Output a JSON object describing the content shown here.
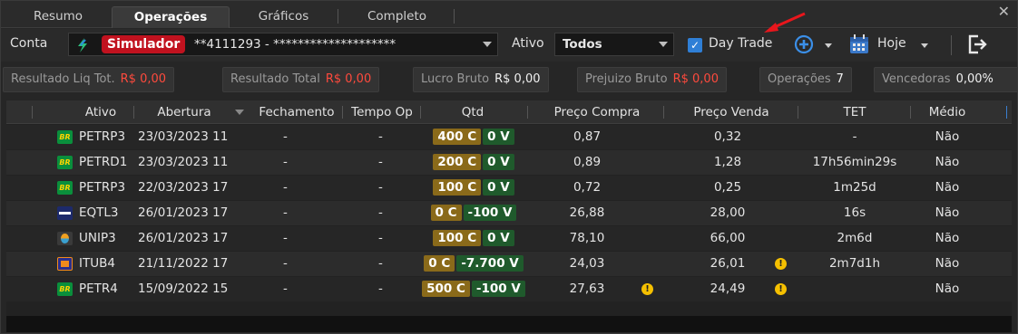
{
  "tabs": [
    {
      "label": "Resumo"
    },
    {
      "label": "Operações"
    },
    {
      "label": "Gráficos"
    },
    {
      "label": "Completo"
    }
  ],
  "toolbar": {
    "conta_label": "Conta",
    "account_badge": "Simulador",
    "account_number": "**4111293 - ********************",
    "ativo_label": "Ativo",
    "ativo_value": "Todos",
    "daytrade_label": "Day Trade",
    "daytrade_checked": true,
    "date_label": "Hoje"
  },
  "summary": [
    {
      "label": "Resultado Liq Tot.",
      "value": "R$ 0,00",
      "color": "#ff4a3d"
    },
    {
      "label": "Resultado Total",
      "value": "R$ 0,00",
      "color": "#ff4a3d"
    },
    {
      "label": "Lucro Bruto",
      "value": "R$ 0,00",
      "color": "#f0f0f0"
    },
    {
      "label": "Prejuizo Bruto",
      "value": "R$ 0,00",
      "color": "#ff4a3d"
    },
    {
      "label": "Operações",
      "value": "7",
      "color": "#f0f0f0"
    },
    {
      "label": "Vencedoras",
      "value": "0,00%",
      "color": "#f0f0f0"
    }
  ],
  "columns": {
    "ativo": "Ativo",
    "abertura": "Abertura",
    "fechamento": "Fechamento",
    "tempo": "Tempo Op",
    "qtd": "Qtd",
    "preco_compra": "Preço Compra",
    "preco_venda": "Preço Venda",
    "tet": "TET",
    "medio": "Médio"
  },
  "rows": [
    {
      "icon": "br-icon",
      "ativo": "PETRP3",
      "abertura": "23/03/2023 11",
      "fechamento": "-",
      "tempo": "-",
      "qtd_c": "400 C",
      "qtd_v": "0 V",
      "preco_compra": "0,87",
      "pc_warn": false,
      "preco_venda": "0,32",
      "pv_warn": false,
      "tet": "-",
      "medio": "Não"
    },
    {
      "icon": "br-icon",
      "ativo": "PETRD1",
      "abertura": "23/03/2023 11",
      "fechamento": "-",
      "tempo": "-",
      "qtd_c": "200 C",
      "qtd_v": "0 V",
      "preco_compra": "0,89",
      "pc_warn": false,
      "preco_venda": "1,28",
      "pv_warn": false,
      "tet": "17h56min29s",
      "medio": "Não"
    },
    {
      "icon": "br-icon",
      "ativo": "PETRP3",
      "abertura": "22/03/2023 17",
      "fechamento": "-",
      "tempo": "-",
      "qtd_c": "100 C",
      "qtd_v": "0 V",
      "preco_compra": "0,72",
      "pc_warn": false,
      "preco_venda": "0,25",
      "pv_warn": false,
      "tet": "1m25d",
      "medio": "Não"
    },
    {
      "icon": "eq-icon",
      "ativo": "EQTL3",
      "abertura": "26/01/2023 17",
      "fechamento": "-",
      "tempo": "-",
      "qtd_c": "0 C",
      "qtd_v": "-100 V",
      "preco_compra": "26,88",
      "pc_warn": false,
      "preco_venda": "28,00",
      "pv_warn": false,
      "tet": "16s",
      "medio": "Não"
    },
    {
      "icon": "un-icon",
      "ativo": "UNIP3",
      "abertura": "26/01/2023 17",
      "fechamento": "-",
      "tempo": "-",
      "qtd_c": "100 C",
      "qtd_v": "0 V",
      "preco_compra": "78,10",
      "pc_warn": false,
      "preco_venda": "66,00",
      "pv_warn": false,
      "tet": "2m6d",
      "medio": "Não"
    },
    {
      "icon": "it-icon",
      "ativo": "ITUB4",
      "abertura": "21/11/2022 17",
      "fechamento": "-",
      "tempo": "-",
      "qtd_c": "0 C",
      "qtd_v": "-7.700 V",
      "preco_compra": "24,03",
      "pc_warn": false,
      "preco_venda": "26,01",
      "pv_warn": true,
      "tet": "2m7d1h",
      "medio": "Não"
    },
    {
      "icon": "br-icon",
      "ativo": "PETR4",
      "abertura": "15/09/2022 15",
      "fechamento": "-",
      "tempo": "-",
      "qtd_c": "500 C",
      "qtd_v": "-100 V",
      "preco_compra": "27,63",
      "pc_warn": true,
      "preco_venda": "24,49",
      "pv_warn": true,
      "tet": "",
      "medio": "Não"
    }
  ]
}
